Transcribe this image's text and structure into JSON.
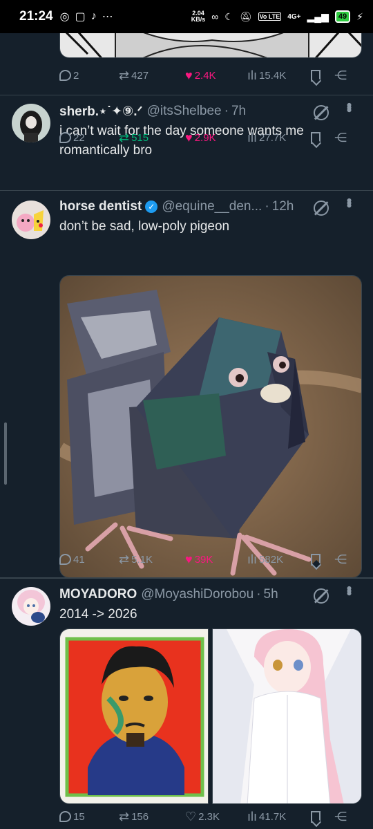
{
  "statusbar": {
    "time": "21:24",
    "netspeed_value": "2.04",
    "netspeed_unit": "KB/s",
    "network": "4G+",
    "volte": "Vo LTE",
    "battery": "49"
  },
  "tweets": [
    {
      "stats": {
        "replies": "2",
        "retweets": "427",
        "likes": "2.4K",
        "views": "15.4K"
      }
    },
    {
      "name": "sherb.⋆˙✦⑨.ᐟ",
      "handle": "@itsShelbee",
      "dot": "·",
      "age": "7h",
      "text": "i can’t wait for the day someone wants me romantically bro",
      "stats": {
        "replies": "22",
        "retweets": "515",
        "likes": "2.9K",
        "views": "27.7K"
      }
    },
    {
      "name": "horse dentist",
      "handle": "@equine__den...",
      "dot": "·",
      "age": "12h",
      "text": "don’t be sad, low-poly pigeon",
      "stats": {
        "replies": "41",
        "retweets": "5.1K",
        "likes": "39K",
        "views": "582K"
      }
    },
    {
      "name": "MOYADORO",
      "handle": "@MoyashiDorobou",
      "dot": "·",
      "age": "5h",
      "text": "2014 -> 2026",
      "stats": {
        "replies": "15",
        "retweets": "156",
        "likes": "2.3K",
        "views": "41.7K"
      }
    }
  ],
  "colors": {
    "background": "#15202b",
    "like": "#f91880",
    "retweet": "#00ba7c",
    "verified": "#1d9bf0",
    "muted": "#8b98a5"
  }
}
